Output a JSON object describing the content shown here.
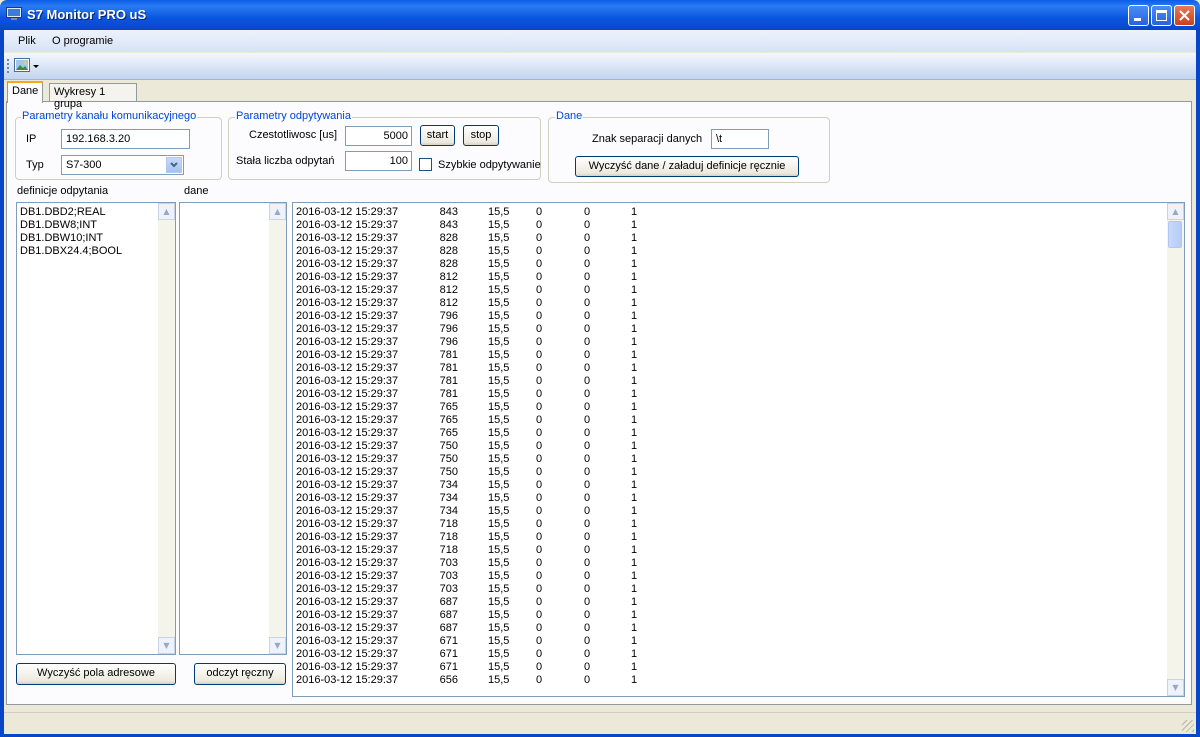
{
  "window": {
    "title": "S7 Monitor PRO uS"
  },
  "menu": {
    "items": [
      "Plik",
      "O programie"
    ]
  },
  "tabs": [
    {
      "label": "Dane"
    },
    {
      "label": "Wykresy 1 grupa"
    }
  ],
  "comm": {
    "title": "Parametry kanału komunikacyjnego",
    "ip_label": "IP",
    "ip_value": "192.168.3.20",
    "type_label": "Typ",
    "type_value": "S7-300"
  },
  "polling": {
    "title": "Parametry odpytywania",
    "freq_label": "Czestotliwosc [us]",
    "freq_value": "5000",
    "start_label": "start",
    "stop_label": "stop",
    "count_label": "Stała liczba odpytań",
    "count_value": "100",
    "fast_label": "Szybkie odpytywanie",
    "fast_checked": false
  },
  "data_group": {
    "title": "Dane",
    "sep_label": "Znak separacji danych",
    "sep_value": "\\t",
    "clear_load_label": "Wyczyść dane / załaduj definicje ręcznie"
  },
  "definitions": {
    "label": "definicje odpytania",
    "items": [
      "DB1.DBD2;REAL",
      "DB1.DBW8;INT",
      "DB1.DBW10;INT",
      "DB1.DBX24.4;BOOL"
    ]
  },
  "dane": {
    "label": "dane"
  },
  "buttons": {
    "clear_addresses": "Wyczyść pola adresowe",
    "manual_read": "odczyt ręczny"
  },
  "log_rows": [
    [
      "2016-03-12 15:29:37",
      "843",
      "15,5",
      "0",
      "0",
      "1"
    ],
    [
      "2016-03-12 15:29:37",
      "843",
      "15,5",
      "0",
      "0",
      "1"
    ],
    [
      "2016-03-12 15:29:37",
      "828",
      "15,5",
      "0",
      "0",
      "1"
    ],
    [
      "2016-03-12 15:29:37",
      "828",
      "15,5",
      "0",
      "0",
      "1"
    ],
    [
      "2016-03-12 15:29:37",
      "828",
      "15,5",
      "0",
      "0",
      "1"
    ],
    [
      "2016-03-12 15:29:37",
      "812",
      "15,5",
      "0",
      "0",
      "1"
    ],
    [
      "2016-03-12 15:29:37",
      "812",
      "15,5",
      "0",
      "0",
      "1"
    ],
    [
      "2016-03-12 15:29:37",
      "812",
      "15,5",
      "0",
      "0",
      "1"
    ],
    [
      "2016-03-12 15:29:37",
      "796",
      "15,5",
      "0",
      "0",
      "1"
    ],
    [
      "2016-03-12 15:29:37",
      "796",
      "15,5",
      "0",
      "0",
      "1"
    ],
    [
      "2016-03-12 15:29:37",
      "796",
      "15,5",
      "0",
      "0",
      "1"
    ],
    [
      "2016-03-12 15:29:37",
      "781",
      "15,5",
      "0",
      "0",
      "1"
    ],
    [
      "2016-03-12 15:29:37",
      "781",
      "15,5",
      "0",
      "0",
      "1"
    ],
    [
      "2016-03-12 15:29:37",
      "781",
      "15,5",
      "0",
      "0",
      "1"
    ],
    [
      "2016-03-12 15:29:37",
      "781",
      "15,5",
      "0",
      "0",
      "1"
    ],
    [
      "2016-03-12 15:29:37",
      "765",
      "15,5",
      "0",
      "0",
      "1"
    ],
    [
      "2016-03-12 15:29:37",
      "765",
      "15,5",
      "0",
      "0",
      "1"
    ],
    [
      "2016-03-12 15:29:37",
      "765",
      "15,5",
      "0",
      "0",
      "1"
    ],
    [
      "2016-03-12 15:29:37",
      "750",
      "15,5",
      "0",
      "0",
      "1"
    ],
    [
      "2016-03-12 15:29:37",
      "750",
      "15,5",
      "0",
      "0",
      "1"
    ],
    [
      "2016-03-12 15:29:37",
      "750",
      "15,5",
      "0",
      "0",
      "1"
    ],
    [
      "2016-03-12 15:29:37",
      "734",
      "15,5",
      "0",
      "0",
      "1"
    ],
    [
      "2016-03-12 15:29:37",
      "734",
      "15,5",
      "0",
      "0",
      "1"
    ],
    [
      "2016-03-12 15:29:37",
      "734",
      "15,5",
      "0",
      "0",
      "1"
    ],
    [
      "2016-03-12 15:29:37",
      "718",
      "15,5",
      "0",
      "0",
      "1"
    ],
    [
      "2016-03-12 15:29:37",
      "718",
      "15,5",
      "0",
      "0",
      "1"
    ],
    [
      "2016-03-12 15:29:37",
      "718",
      "15,5",
      "0",
      "0",
      "1"
    ],
    [
      "2016-03-12 15:29:37",
      "703",
      "15,5",
      "0",
      "0",
      "1"
    ],
    [
      "2016-03-12 15:29:37",
      "703",
      "15,5",
      "0",
      "0",
      "1"
    ],
    [
      "2016-03-12 15:29:37",
      "703",
      "15,5",
      "0",
      "0",
      "1"
    ],
    [
      "2016-03-12 15:29:37",
      "687",
      "15,5",
      "0",
      "0",
      "1"
    ],
    [
      "2016-03-12 15:29:37",
      "687",
      "15,5",
      "0",
      "0",
      "1"
    ],
    [
      "2016-03-12 15:29:37",
      "687",
      "15,5",
      "0",
      "0",
      "1"
    ],
    [
      "2016-03-12 15:29:37",
      "671",
      "15,5",
      "0",
      "0",
      "1"
    ],
    [
      "2016-03-12 15:29:37",
      "671",
      "15,5",
      "0",
      "0",
      "1"
    ],
    [
      "2016-03-12 15:29:37",
      "671",
      "15,5",
      "0",
      "0",
      "1"
    ],
    [
      "2016-03-12 15:29:37",
      "656",
      "15,5",
      "0",
      "0",
      "1"
    ]
  ],
  "colors": {
    "titlebar": "#0b55e0",
    "group_title": "#0046d5",
    "face": "#ece9d8"
  }
}
